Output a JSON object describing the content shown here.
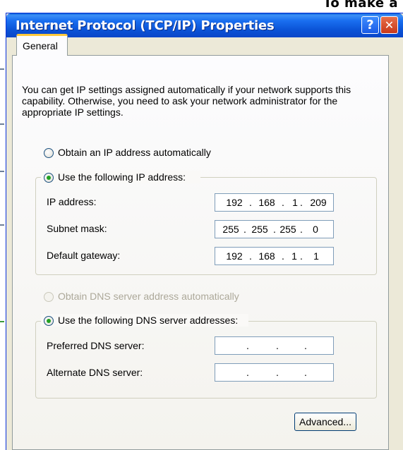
{
  "background": {
    "corner_text": "To make a"
  },
  "window": {
    "title": "Internet Protocol (TCP/IP) Properties",
    "help_label": "?",
    "close_label": "✕"
  },
  "tab": {
    "label": "General"
  },
  "intro": "You can get IP settings assigned automatically if your network supports this capability. Otherwise, you need to ask your network administrator for the appropriate IP settings.",
  "ip": {
    "auto_label": "Obtain an IP address automatically",
    "manual_label": "Use the following IP address:",
    "selected": "manual",
    "fields": [
      {
        "label": "IP address:",
        "octets": [
          "192",
          "168",
          "1",
          "209"
        ]
      },
      {
        "label": "Subnet mask:",
        "octets": [
          "255",
          "255",
          "255",
          "0"
        ]
      },
      {
        "label": "Default gateway:",
        "octets": [
          "192",
          "168",
          "1",
          "1"
        ]
      }
    ]
  },
  "dns": {
    "auto_label": "Obtain DNS server address automatically",
    "manual_label": "Use the following DNS server addresses:",
    "selected": "manual",
    "fields": [
      {
        "label": "Preferred DNS server:",
        "octets": [
          "",
          "",
          "",
          ""
        ]
      },
      {
        "label": "Alternate DNS server:",
        "octets": [
          "",
          "",
          "",
          ""
        ]
      }
    ]
  },
  "advanced_label": "Advanced...",
  "colors": {
    "title_blue": "#0a52d6",
    "radio_green": "#21a121",
    "dialog_bg": "#ece9d8"
  }
}
